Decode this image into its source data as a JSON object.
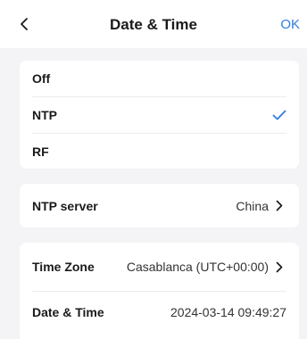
{
  "header": {
    "title": "Date & Time",
    "ok_label": "OK"
  },
  "sync_mode": {
    "options": [
      {
        "label": "Off",
        "selected": false
      },
      {
        "label": "NTP",
        "selected": true
      },
      {
        "label": "RF",
        "selected": false
      }
    ]
  },
  "ntp": {
    "label": "NTP server",
    "value": "China"
  },
  "time_zone": {
    "label": "Time Zone",
    "value": "Casablanca (UTC+00:00)"
  },
  "date_time": {
    "label": "Date & Time",
    "value": "2024-03-14 09:49:27"
  },
  "colors": {
    "accent": "#2f7de1",
    "background": "#f4f4f6",
    "card": "#ffffff"
  },
  "icons": {
    "back": "chevron-left-icon",
    "selected": "checkmark-icon",
    "forward": "chevron-right-icon"
  }
}
